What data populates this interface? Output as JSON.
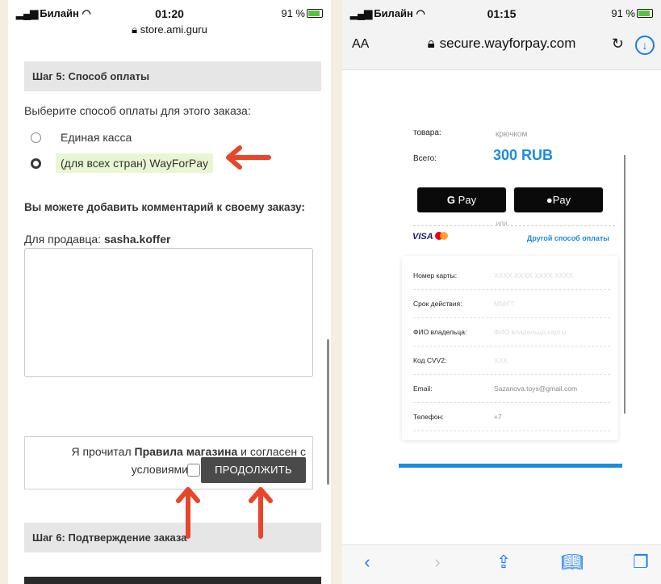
{
  "left": {
    "status": {
      "carrier": "Билайн",
      "time": "01:20",
      "battery": "91 %"
    },
    "url": "store.ami.guru",
    "step5_title": "Шаг 5: Способ оплаты",
    "choose_text": "Выберите способ оплаты для этого заказа:",
    "payment_options": [
      {
        "label": "Единая касса",
        "selected": false
      },
      {
        "label": "(для всех стран) WayForPay",
        "selected": true
      }
    ],
    "comment_prompt": "Вы можете добавить комментарий к своему заказу:",
    "seller_label": "Для продавца: ",
    "seller_name": "sasha.koffer",
    "agree_prefix": "Я прочитал ",
    "agree_link": "Правила магазина",
    "agree_suffix": " и согласен с условиями",
    "continue_label": "ПРОДОЛЖИТЬ",
    "step6_title": "Шаг 6: Подтверждение заказа"
  },
  "right": {
    "status": {
      "carrier": "Билайн",
      "time": "01:15",
      "battery": "91 %"
    },
    "aa_label": "AA",
    "url": "secure.wayforpay.com",
    "goods_label": "товара:",
    "goods_value": "крючком",
    "total_label": "Всего:",
    "total_value": "300 RUB",
    "gpay_label": "Pay",
    "apay_label": "Pay",
    "or_text": "или",
    "visa_label": "VISA",
    "other_method": "Другой способ оплаты",
    "fields": [
      {
        "label": "Номер карты:",
        "value": "XXXX XXXX XXXX XXXX",
        "placeholder": true
      },
      {
        "label": "Срок действия:",
        "value": "ММ/ГГ",
        "placeholder": true
      },
      {
        "label": "ФИО владельца:",
        "value": "ФИО владельца карты",
        "placeholder": true
      },
      {
        "label": "Код CVV2:",
        "value": "XXX",
        "placeholder": true
      },
      {
        "label": "Email:",
        "value": "Sazanova.toys@gmail.com",
        "placeholder": false
      },
      {
        "label": "Телефон:",
        "value": "+7",
        "placeholder": false
      }
    ]
  },
  "colors": {
    "accent": "#1a8be0",
    "arrow": "#e8452a",
    "highlight": "#e8f7d2"
  }
}
